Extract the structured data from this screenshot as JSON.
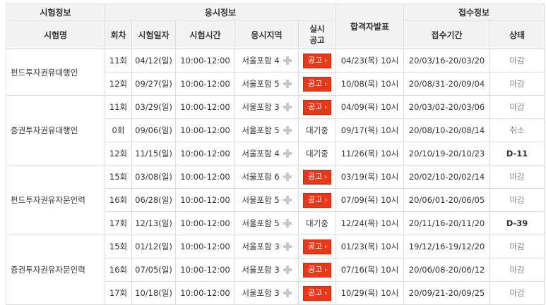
{
  "headers": {
    "group_exam": "시험정보",
    "group_apply": "응시정보",
    "group_receipt": "접수정보",
    "exam_name": "시험명",
    "round": "회차",
    "exam_date": "시험일자",
    "exam_time": "시험시간",
    "region": "응시지역",
    "notice_line1": "실시",
    "notice_line2": "공고",
    "result": "합격자발표",
    "period": "접수기간",
    "status": "상태"
  },
  "notice_label": "공고",
  "notice_arrow": "›",
  "groups": [
    {
      "name": "펀드투자권유대행인",
      "rows": [
        {
          "round": "11회",
          "date": "04/12(일)",
          "time": "10:00-12:00",
          "region": "서울포함 4",
          "notice": "button",
          "notice_text": "",
          "result": "04/23(목) 10시",
          "period": "20/03/16-20/03/20",
          "status": "마감",
          "status_type": "closed"
        },
        {
          "round": "12회",
          "date": "09/27(일)",
          "time": "10:00-12:00",
          "region": "서울포함 5",
          "notice": "button",
          "notice_text": "",
          "result": "10/08(목) 10시",
          "period": "20/08/31-20/09/04",
          "status": "마감",
          "status_type": "closed"
        }
      ]
    },
    {
      "name": "증권투자권유대행인",
      "rows": [
        {
          "round": "11회",
          "date": "03/29(일)",
          "time": "10:00-12:00",
          "region": "서울포함 3",
          "notice": "button",
          "notice_text": "",
          "result": "04/09(목) 10시",
          "period": "20/03/02-20/03/06",
          "status": "마감",
          "status_type": "closed"
        },
        {
          "round": "0회",
          "date": "09/06(일)",
          "time": "10:00-12:00",
          "region": "서울포함 5",
          "notice": "text",
          "notice_text": "대기중",
          "result": "09/17(목) 10시",
          "period": "20/08/10-20/08/14",
          "status": "취소",
          "status_type": "closed"
        },
        {
          "round": "12회",
          "date": "11/15(일)",
          "time": "10:00-12:00",
          "region": "서울포함 4",
          "notice": "text",
          "notice_text": "대기중",
          "result": "11/26(목) 10시",
          "period": "20/10/19-20/10/23",
          "status": "D-11",
          "status_type": "dday"
        }
      ]
    },
    {
      "name": "펀드투자권유자문인력",
      "rows": [
        {
          "round": "15회",
          "date": "03/08(일)",
          "time": "10:00-12:00",
          "region": "서울포함 6",
          "notice": "button",
          "notice_text": "",
          "result": "03/19(목) 10시",
          "period": "20/02/10-20/02/14",
          "status": "마감",
          "status_type": "closed"
        },
        {
          "round": "16회",
          "date": "06/28(일)",
          "time": "10:00-12:00",
          "region": "서울포함 5",
          "notice": "button",
          "notice_text": "",
          "result": "07/09(목) 10시",
          "period": "20/06/01-20/06/05",
          "status": "마감",
          "status_type": "closed"
        },
        {
          "round": "17회",
          "date": "12/13(일)",
          "time": "10:00-12:00",
          "region": "서울포함 5",
          "notice": "text",
          "notice_text": "대기중",
          "result": "12/24(목) 10시",
          "period": "20/11/16-20/11/20",
          "status": "D-39",
          "status_type": "dday"
        }
      ]
    },
    {
      "name": "증권투자권유자문인력",
      "rows": [
        {
          "round": "15회",
          "date": "01/12(일)",
          "time": "10:00-12:00",
          "region": "서울포함 3",
          "notice": "button",
          "notice_text": "",
          "result": "01/23(목) 10시",
          "period": "19/12/16-19/12/20",
          "status": "마감",
          "status_type": "closed"
        },
        {
          "round": "16회",
          "date": "07/05(일)",
          "time": "10:00-12:00",
          "region": "서울포함 3",
          "notice": "button",
          "notice_text": "",
          "result": "07/16(목) 10시",
          "period": "20/06/08-20/06/12",
          "status": "마감",
          "status_type": "closed"
        },
        {
          "round": "17회",
          "date": "10/18(일)",
          "time": "10:00-12:00",
          "region": "서울포함 3",
          "notice": "button",
          "notice_text": "",
          "result": "10/29(목) 10시",
          "period": "20/09/21-20/09/25",
          "status": "마감",
          "status_type": "closed"
        }
      ]
    }
  ]
}
